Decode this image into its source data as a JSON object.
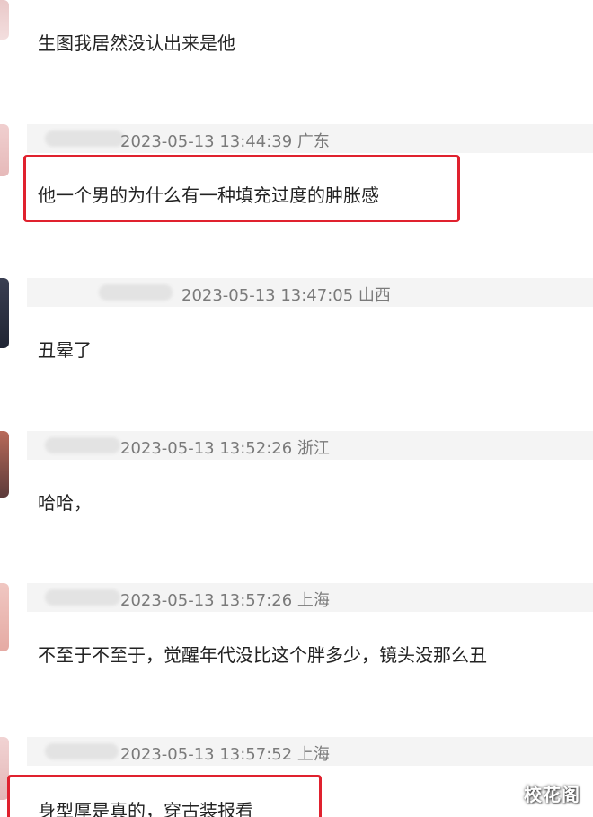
{
  "comments": [
    {
      "location_time": "",
      "text": "生图我居然没认出来是他"
    },
    {
      "location_time": "2023-05-13 13:44:39 广东",
      "text": "他一个男的为什么有一种填充过度的肿胀感"
    },
    {
      "location_time": "2023-05-13 13:47:05 山西",
      "text": "丑晕了"
    },
    {
      "location_time": "2023-05-13 13:52:26 浙江",
      "text": "哈哈，"
    },
    {
      "location_time": "2023-05-13 13:57:26 上海",
      "text": "不至于不至于，觉醒年代没比这个胖多少，镜头没那么丑"
    },
    {
      "location_time": "2023-05-13 13:57:52 上海",
      "text": "身型厚是真的，穿古装报看"
    }
  ],
  "watermark": "校花阁",
  "colors": {
    "highlight": "#e0212e",
    "meta_bg": "#f4f4f4",
    "meta_text": "#7a7a7a",
    "comment_text": "#222222"
  },
  "icons": {
    "avatar": "user-avatar-icon"
  }
}
